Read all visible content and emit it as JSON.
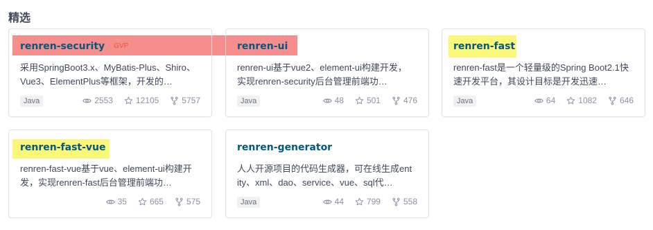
{
  "section": {
    "title": "精选"
  },
  "cards": [
    {
      "name": "renren-security",
      "badge": "GVP",
      "description": "采用SpringBoot3.x、MyBatis-Plus、Shiro、Vue3、ElementPlus等框架，开发的…",
      "language": "Java",
      "views": "2553",
      "stars": "12105",
      "forks": "5757"
    },
    {
      "name": "renren-ui",
      "description": "renren-ui基于vue2、element-ui构建开发，实现renren-security后台管理前端功…",
      "language": "Java",
      "views": "48",
      "stars": "501",
      "forks": "476"
    },
    {
      "name": "renren-fast",
      "description": "renren-fast是一个轻量级的Spring Boot2.1快速开发平台，其设计目标是开发迅速…",
      "language": "Java",
      "views": "64",
      "stars": "1082",
      "forks": "646"
    },
    {
      "name": "renren-fast-vue",
      "description": "renren-fast-vue基于vue、element-ui构建开发，实现renren-fast后台管理前端功…",
      "language": "",
      "views": "35",
      "stars": "665",
      "forks": "575"
    },
    {
      "name": "renren-generator",
      "description": "人人开源项目的代码生成器，可在线生成entity、xml、dao、service、vue、sql代…",
      "language": "Java",
      "views": "44",
      "stars": "799",
      "forks": "558"
    }
  ],
  "colors": {
    "repo_name": "#005980",
    "badge": "#e25c2f",
    "highlight_red": "#f46e6e",
    "highlight_yellow": "#faf66e"
  },
  "icons": [
    "eye-icon",
    "star-icon",
    "fork-icon"
  ]
}
